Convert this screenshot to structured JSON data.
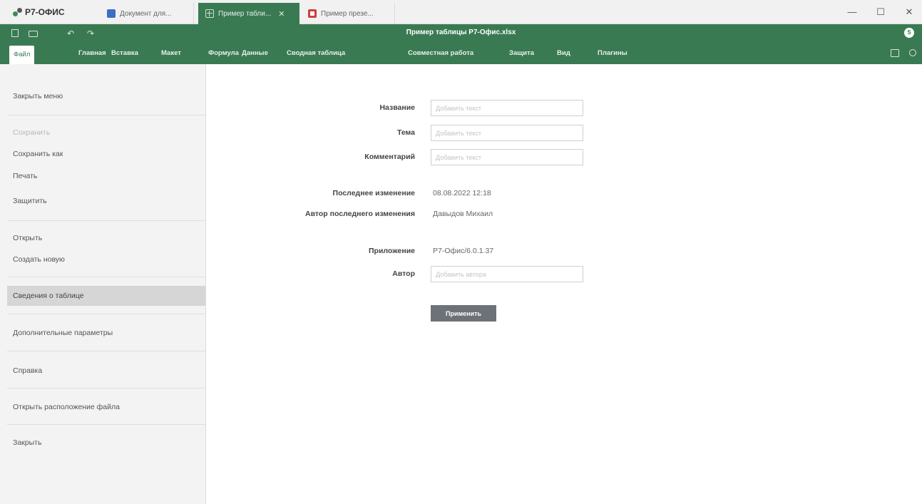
{
  "app": {
    "logo_text": "Р7-ОФИС"
  },
  "tabs": [
    {
      "label": "Документ для..."
    },
    {
      "label": "Пример табли..."
    },
    {
      "label": "Пример презе..."
    }
  ],
  "window": {
    "minimize": "—",
    "maximize": "☐",
    "close": "✕"
  },
  "toolbar": {
    "document_title": "Пример таблицы Р7-Офис.xlsx",
    "undo_icon": "↶",
    "redo_icon": "↷",
    "user_initial": "S"
  },
  "menu": {
    "items": [
      "Файл",
      "Главная",
      "Вставка",
      "Макет",
      "Формула",
      "Данные",
      "Сводная таблица",
      "Совместная работа",
      "Защита",
      "Вид",
      "Плагины"
    ]
  },
  "sidebar": {
    "items": [
      {
        "label": "Закрыть меню"
      },
      {
        "label": "Сохранить"
      },
      {
        "label": "Сохранить как"
      },
      {
        "label": "Печать"
      },
      {
        "label": "Защитить"
      },
      {
        "label": "Открыть"
      },
      {
        "label": "Создать новую"
      },
      {
        "label": "Сведения о таблице"
      },
      {
        "label": "Дополнительные параметры"
      },
      {
        "label": "Справка"
      },
      {
        "label": "Открыть расположение файла"
      },
      {
        "label": "Закрыть"
      }
    ]
  },
  "info": {
    "title_label": "Название",
    "title_placeholder": "Добавить текст",
    "subject_label": "Тема",
    "subject_placeholder": "Добавить текст",
    "comment_label": "Комментарий",
    "comment_placeholder": "Добавить текст",
    "last_modified_label": "Последнее изменение",
    "last_modified_value": "08.08.2022 12:18",
    "last_modified_by_label": "Автор последнего изменения",
    "last_modified_by_value": "Давыдов Михаил",
    "application_label": "Приложение",
    "application_value": "Р7-Офис/6.0.1.37",
    "author_label": "Автор",
    "author_placeholder": "Добавить автора",
    "apply_label": "Применить"
  }
}
